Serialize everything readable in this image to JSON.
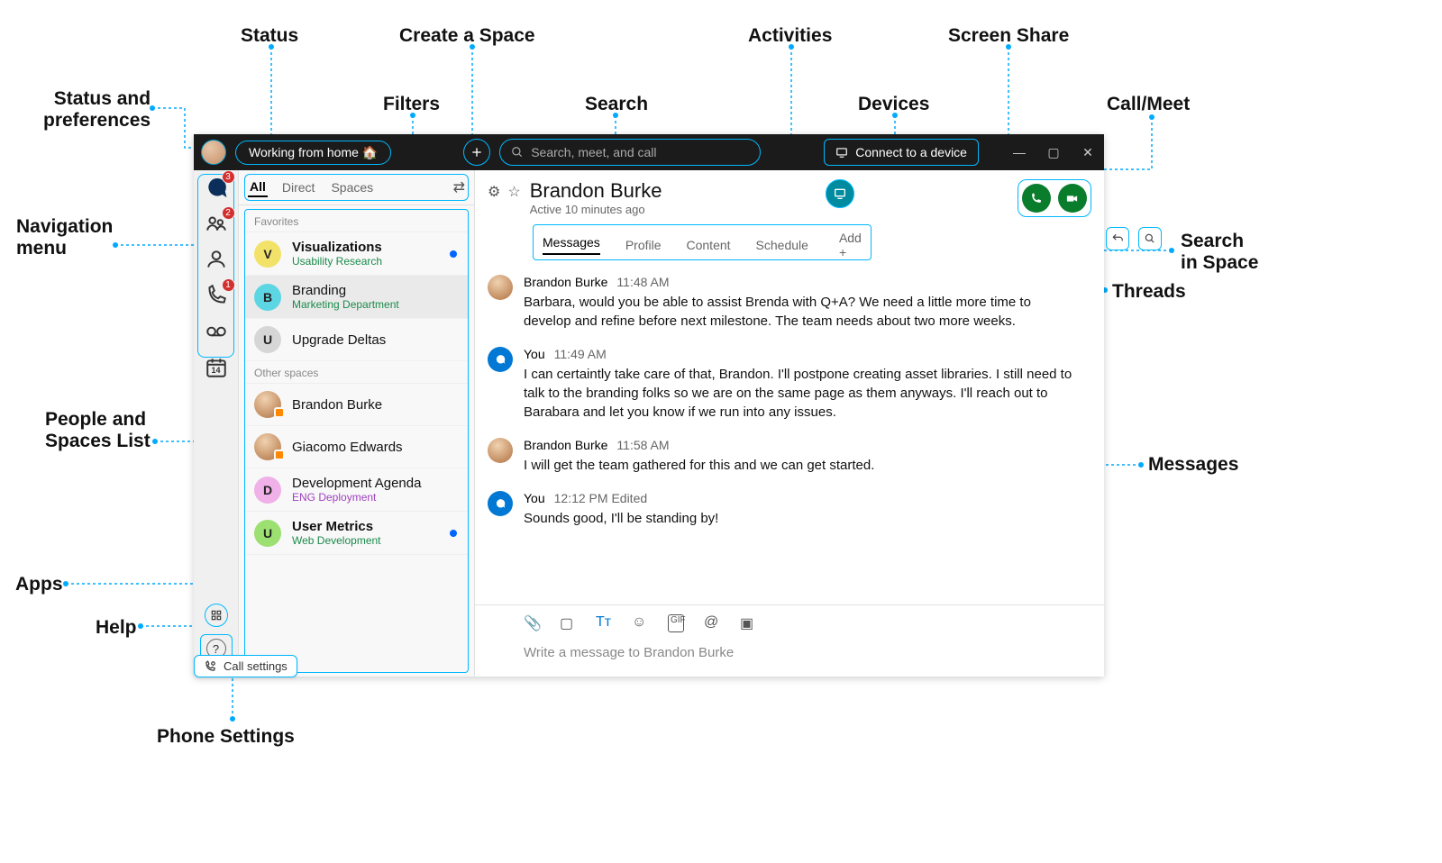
{
  "labels": {
    "status": "Status",
    "create_space": "Create a Space",
    "activities": "Activities",
    "screen_share": "Screen Share",
    "status_prefs": "Status and\npreferences",
    "filters": "Filters",
    "search_lbl": "Search",
    "devices": "Devices",
    "call_meet": "Call/Meet",
    "nav_menu": "Navigation\nmenu",
    "search_in_space": "Search\nin Space",
    "threads": "Threads",
    "people_spaces": "People and\nSpaces List",
    "messages_lbl": "Messages",
    "apps": "Apps",
    "help": "Help",
    "phone_settings": "Phone Settings"
  },
  "titlebar": {
    "status_text": "Working from home 🏠",
    "search_placeholder": "Search, meet, and call",
    "device_text": "Connect to a device"
  },
  "nav": {
    "chat_badge": "3",
    "teams_badge": "2",
    "calls_badge": "1",
    "help_label": "Help",
    "calendar_day": "14"
  },
  "filters": {
    "all": "All",
    "direct": "Direct",
    "spaces": "Spaces"
  },
  "sidebar": {
    "section_fav": "Favorites",
    "section_other": "Other spaces",
    "items": [
      {
        "avatar": "V",
        "color": "#f2e26a",
        "title": "Visualizations",
        "sub": "Usability Research",
        "unread": true,
        "subcls": ""
      },
      {
        "avatar": "B",
        "color": "#5dd6e3",
        "title": "Branding",
        "sub": "Marketing Department",
        "unread": false,
        "selected": true,
        "subcls": ""
      },
      {
        "avatar": "U",
        "color": "#d6d6d6",
        "title": "Upgrade Deltas",
        "sub": "",
        "unread": false,
        "subcls": "gray"
      }
    ],
    "others": [
      {
        "title": "Brandon Burke",
        "sub": "",
        "presence": "orange"
      },
      {
        "title": "Giacomo Edwards",
        "sub": "",
        "presence": "orange"
      },
      {
        "avatar": "D",
        "color": "#f0b0e8",
        "title": "Development Agenda",
        "sub": "ENG Deployment",
        "subcls": "purple"
      },
      {
        "avatar": "U",
        "color": "#9be070",
        "title": "User Metrics",
        "sub": "Web Development",
        "unread": true,
        "subcls": ""
      }
    ]
  },
  "chat": {
    "title": "Brandon Burke",
    "subtitle": "Active 10 minutes ago",
    "tabs": {
      "messages": "Messages",
      "profile": "Profile",
      "content": "Content",
      "schedule": "Schedule",
      "add": "Add"
    },
    "messages": [
      {
        "author": "Brandon Burke",
        "time": "11:48 AM",
        "self": false,
        "text": "Barbara, would you be able to assist Brenda with Q+A? We need a little more time to develop and refine before next milestone. The team needs about two more weeks."
      },
      {
        "author": "You",
        "time": "11:49 AM",
        "self": true,
        "text": "I can certaintly take care of that, Brandon. I'll postpone creating asset libraries. I still need to talk to the branding folks so we are on the same page as them anyways. I'll reach out to Barabara and let you know if we run into any issues."
      },
      {
        "author": "Brandon Burke",
        "time": "11:58 AM",
        "self": false,
        "text": "I will get the team gathered for this and we can get started."
      },
      {
        "author": "You",
        "time": "12:12 PM Edited",
        "self": true,
        "text": "Sounds good, I'll be standing by!"
      }
    ],
    "composer_placeholder": "Write a message to Brandon Burke"
  },
  "call_settings": "Call settings"
}
